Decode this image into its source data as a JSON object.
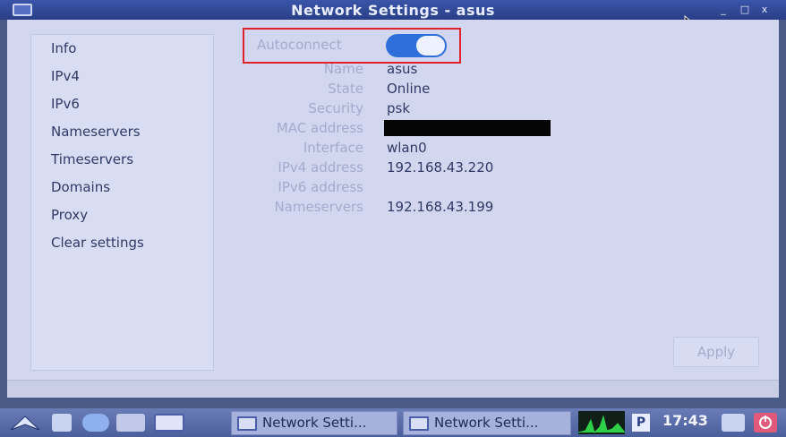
{
  "window": {
    "title": "Network Settings - asus",
    "controls": [
      "_",
      "□",
      "x"
    ]
  },
  "sidebar": {
    "items": [
      {
        "label": "Info"
      },
      {
        "label": "IPv4"
      },
      {
        "label": "IPv6"
      },
      {
        "label": "Nameservers"
      },
      {
        "label": "Timeservers"
      },
      {
        "label": "Domains"
      },
      {
        "label": "Proxy"
      },
      {
        "label": "Clear settings"
      }
    ]
  },
  "info": {
    "autoconnect": {
      "label": "Autoconnect",
      "enabled": true
    },
    "fields": [
      {
        "label": "Name",
        "value": "asus"
      },
      {
        "label": "State",
        "value": "Online"
      },
      {
        "label": "Security",
        "value": "psk"
      },
      {
        "label": "MAC address",
        "value": ""
      },
      {
        "label": "Interface",
        "value": "wlan0"
      },
      {
        "label": "IPv4 address",
        "value": "192.168.43.220"
      },
      {
        "label": "IPv6 address",
        "value": ""
      },
      {
        "label": "Nameservers",
        "value": "192.168.43.199"
      }
    ]
  },
  "footer": {
    "apply_label": "Apply"
  },
  "taskbar": {
    "tasks": [
      {
        "label": "Network Setti..."
      },
      {
        "label": "Network Setti..."
      }
    ],
    "pager_label": "P",
    "clock": "17:43"
  },
  "colors": {
    "accent": "#2f6fdb",
    "highlight": "#e0222a",
    "titlebar": "#2a3f86"
  }
}
